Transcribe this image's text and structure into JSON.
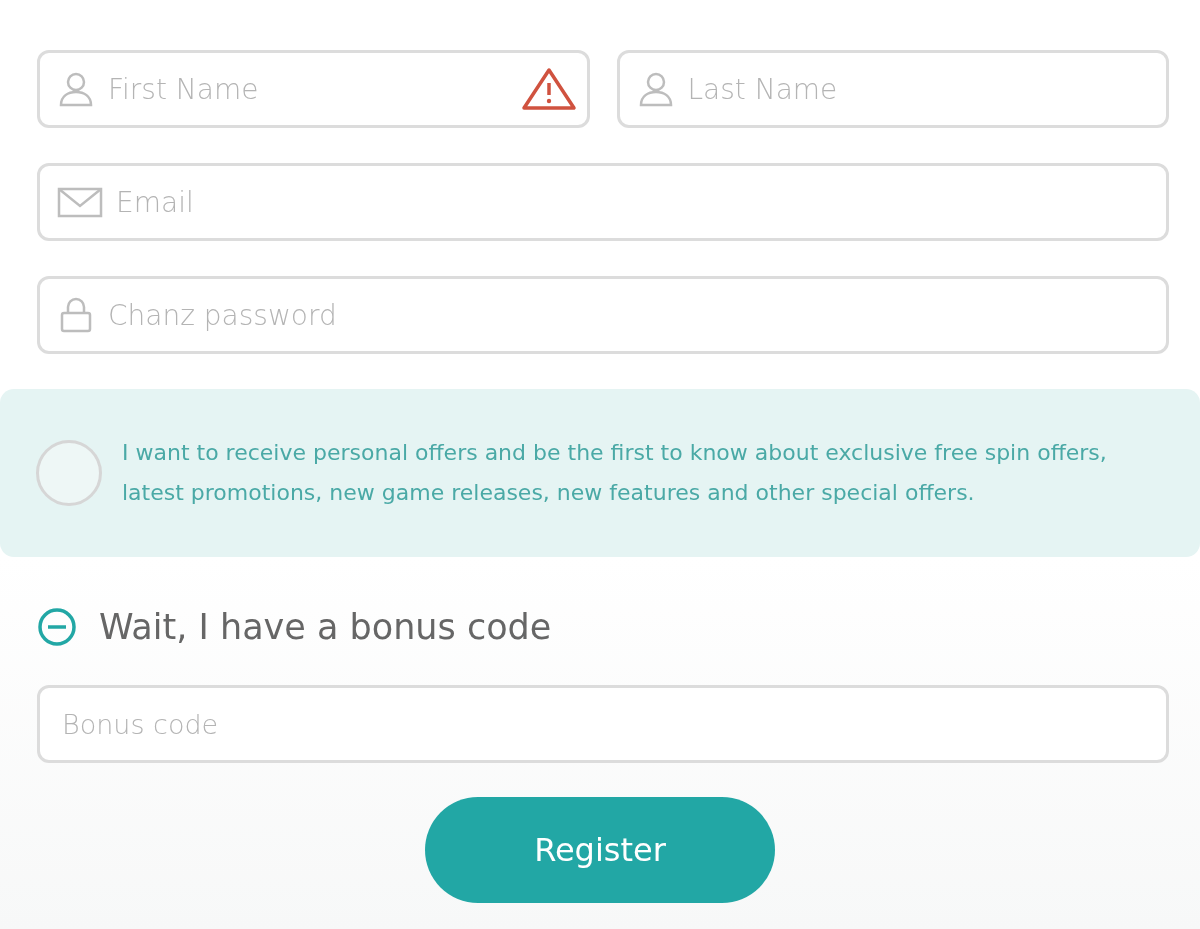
{
  "name_fields": [
    {
      "kind": "person",
      "placeholder": "First Name",
      "error": true
    },
    {
      "kind": "person",
      "placeholder": "Last Name",
      "error": false
    }
  ],
  "fields": [
    {
      "kind": "mail",
      "placeholder": "Email",
      "error": false
    },
    {
      "kind": "lock",
      "placeholder": "Chanz password",
      "error": false
    }
  ],
  "consent": {
    "text": "I want to receive personal offers and be the first to know about exclusive free spin offers, latest promotions, new game releases, new features and other special offers.",
    "checked": false
  },
  "bonus_toggle": {
    "label": "Wait, I have a bonus code",
    "expanded": true
  },
  "bonus_field": {
    "placeholder": "Bonus code"
  },
  "register_button": {
    "label": "Register"
  }
}
